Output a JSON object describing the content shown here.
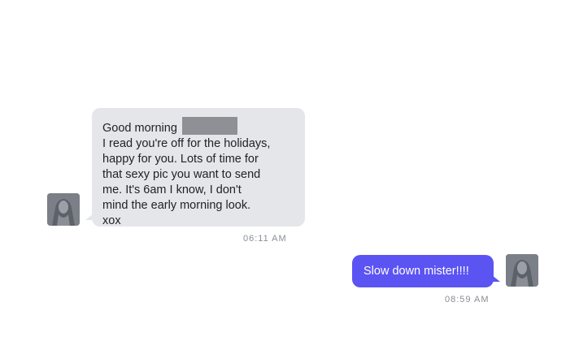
{
  "conversation": {
    "incoming": {
      "greeting": "Good morning",
      "lines": [
        "I read you're off for the holidays,",
        "happy for you. Lots of time for",
        "that sexy pic you want to send",
        "me. It's 6am I know, I don't",
        "mind the early morning look.",
        "xox"
      ],
      "timestamp": "06:11 AM",
      "avatar_icon": "person-photo-icon"
    },
    "outgoing": {
      "text": "Slow down mister!!!!",
      "timestamp": "08:59 AM",
      "avatar_icon": "person-photo-icon"
    }
  },
  "colors": {
    "incoming_bubble": "#e5e6ea",
    "outgoing_bubble": "#5b53f2",
    "timestamp": "#8a8d94",
    "redaction": "#8e9095"
  }
}
